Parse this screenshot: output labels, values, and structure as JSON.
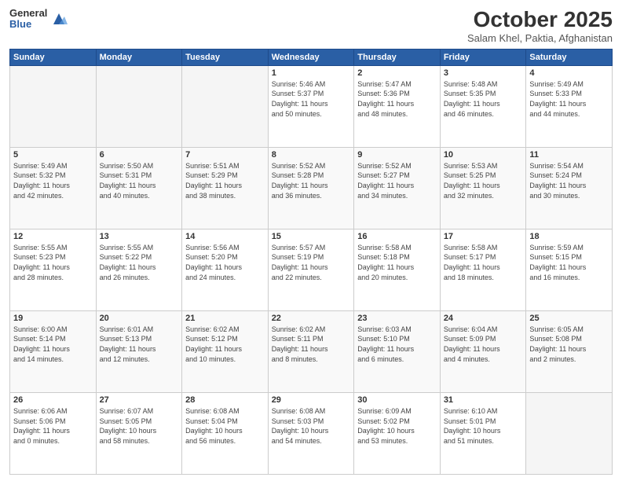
{
  "logo": {
    "general": "General",
    "blue": "Blue"
  },
  "header": {
    "month": "October 2025",
    "location": "Salam Khel, Paktia, Afghanistan"
  },
  "weekdays": [
    "Sunday",
    "Monday",
    "Tuesday",
    "Wednesday",
    "Thursday",
    "Friday",
    "Saturday"
  ],
  "weeks": [
    [
      {
        "day": "",
        "info": ""
      },
      {
        "day": "",
        "info": ""
      },
      {
        "day": "",
        "info": ""
      },
      {
        "day": "1",
        "info": "Sunrise: 5:46 AM\nSunset: 5:37 PM\nDaylight: 11 hours\nand 50 minutes."
      },
      {
        "day": "2",
        "info": "Sunrise: 5:47 AM\nSunset: 5:36 PM\nDaylight: 11 hours\nand 48 minutes."
      },
      {
        "day": "3",
        "info": "Sunrise: 5:48 AM\nSunset: 5:35 PM\nDaylight: 11 hours\nand 46 minutes."
      },
      {
        "day": "4",
        "info": "Sunrise: 5:49 AM\nSunset: 5:33 PM\nDaylight: 11 hours\nand 44 minutes."
      }
    ],
    [
      {
        "day": "5",
        "info": "Sunrise: 5:49 AM\nSunset: 5:32 PM\nDaylight: 11 hours\nand 42 minutes."
      },
      {
        "day": "6",
        "info": "Sunrise: 5:50 AM\nSunset: 5:31 PM\nDaylight: 11 hours\nand 40 minutes."
      },
      {
        "day": "7",
        "info": "Sunrise: 5:51 AM\nSunset: 5:29 PM\nDaylight: 11 hours\nand 38 minutes."
      },
      {
        "day": "8",
        "info": "Sunrise: 5:52 AM\nSunset: 5:28 PM\nDaylight: 11 hours\nand 36 minutes."
      },
      {
        "day": "9",
        "info": "Sunrise: 5:52 AM\nSunset: 5:27 PM\nDaylight: 11 hours\nand 34 minutes."
      },
      {
        "day": "10",
        "info": "Sunrise: 5:53 AM\nSunset: 5:25 PM\nDaylight: 11 hours\nand 32 minutes."
      },
      {
        "day": "11",
        "info": "Sunrise: 5:54 AM\nSunset: 5:24 PM\nDaylight: 11 hours\nand 30 minutes."
      }
    ],
    [
      {
        "day": "12",
        "info": "Sunrise: 5:55 AM\nSunset: 5:23 PM\nDaylight: 11 hours\nand 28 minutes."
      },
      {
        "day": "13",
        "info": "Sunrise: 5:55 AM\nSunset: 5:22 PM\nDaylight: 11 hours\nand 26 minutes."
      },
      {
        "day": "14",
        "info": "Sunrise: 5:56 AM\nSunset: 5:20 PM\nDaylight: 11 hours\nand 24 minutes."
      },
      {
        "day": "15",
        "info": "Sunrise: 5:57 AM\nSunset: 5:19 PM\nDaylight: 11 hours\nand 22 minutes."
      },
      {
        "day": "16",
        "info": "Sunrise: 5:58 AM\nSunset: 5:18 PM\nDaylight: 11 hours\nand 20 minutes."
      },
      {
        "day": "17",
        "info": "Sunrise: 5:58 AM\nSunset: 5:17 PM\nDaylight: 11 hours\nand 18 minutes."
      },
      {
        "day": "18",
        "info": "Sunrise: 5:59 AM\nSunset: 5:15 PM\nDaylight: 11 hours\nand 16 minutes."
      }
    ],
    [
      {
        "day": "19",
        "info": "Sunrise: 6:00 AM\nSunset: 5:14 PM\nDaylight: 11 hours\nand 14 minutes."
      },
      {
        "day": "20",
        "info": "Sunrise: 6:01 AM\nSunset: 5:13 PM\nDaylight: 11 hours\nand 12 minutes."
      },
      {
        "day": "21",
        "info": "Sunrise: 6:02 AM\nSunset: 5:12 PM\nDaylight: 11 hours\nand 10 minutes."
      },
      {
        "day": "22",
        "info": "Sunrise: 6:02 AM\nSunset: 5:11 PM\nDaylight: 11 hours\nand 8 minutes."
      },
      {
        "day": "23",
        "info": "Sunrise: 6:03 AM\nSunset: 5:10 PM\nDaylight: 11 hours\nand 6 minutes."
      },
      {
        "day": "24",
        "info": "Sunrise: 6:04 AM\nSunset: 5:09 PM\nDaylight: 11 hours\nand 4 minutes."
      },
      {
        "day": "25",
        "info": "Sunrise: 6:05 AM\nSunset: 5:08 PM\nDaylight: 11 hours\nand 2 minutes."
      }
    ],
    [
      {
        "day": "26",
        "info": "Sunrise: 6:06 AM\nSunset: 5:06 PM\nDaylight: 11 hours\nand 0 minutes."
      },
      {
        "day": "27",
        "info": "Sunrise: 6:07 AM\nSunset: 5:05 PM\nDaylight: 10 hours\nand 58 minutes."
      },
      {
        "day": "28",
        "info": "Sunrise: 6:08 AM\nSunset: 5:04 PM\nDaylight: 10 hours\nand 56 minutes."
      },
      {
        "day": "29",
        "info": "Sunrise: 6:08 AM\nSunset: 5:03 PM\nDaylight: 10 hours\nand 54 minutes."
      },
      {
        "day": "30",
        "info": "Sunrise: 6:09 AM\nSunset: 5:02 PM\nDaylight: 10 hours\nand 53 minutes."
      },
      {
        "day": "31",
        "info": "Sunrise: 6:10 AM\nSunset: 5:01 PM\nDaylight: 10 hours\nand 51 minutes."
      },
      {
        "day": "",
        "info": ""
      }
    ]
  ]
}
